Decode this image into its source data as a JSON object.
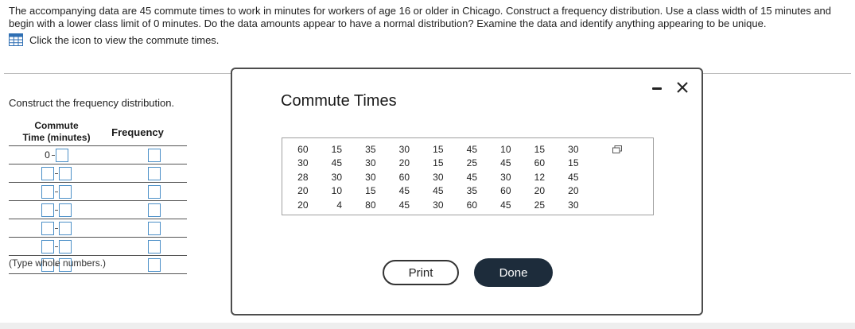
{
  "question": {
    "text": "The accompanying data are 45 commute times to work in minutes for workers of age 16 or older in Chicago. Construct a frequency distribution. Use a class width of 15 minutes and begin with a lower class limit of 0 minutes. Do the data amounts appear to have a normal distribution? Examine the data and identify anything appearing to be unique.",
    "link_text": "Click the icon to view the commute times."
  },
  "freq_section": {
    "label": "Construct the frequency distribution.",
    "col_commute_line1": "Commute",
    "col_commute_line2": "Time (minutes)",
    "col_frequency": "Frequency",
    "first_lower": "0",
    "rows": 7,
    "note": "(Type whole numbers.)"
  },
  "dialog": {
    "title": "Commute Times",
    "data_rows": [
      [
        "60",
        "15",
        "35",
        "30",
        "15",
        "45",
        "10",
        "15",
        "30"
      ],
      [
        "30",
        "45",
        "30",
        "20",
        "15",
        "25",
        "45",
        "60",
        "15"
      ],
      [
        "28",
        "30",
        "30",
        "60",
        "30",
        "45",
        "30",
        "12",
        "45"
      ],
      [
        "20",
        "10",
        "15",
        "45",
        "45",
        "35",
        "60",
        "20",
        "20"
      ],
      [
        "20",
        "4",
        "80",
        "45",
        "30",
        "60",
        "45",
        "25",
        "30"
      ]
    ],
    "print_label": "Print",
    "done_label": "Done"
  },
  "icons": {
    "view_data": "grid-table-icon",
    "minimize": "minimize-icon",
    "close": "close-icon",
    "copy": "copy-icon"
  },
  "colors": {
    "input_border": "#4b8fc7",
    "done_bg": "#1d2c3b",
    "dialog_border": "#4d4d4d"
  }
}
